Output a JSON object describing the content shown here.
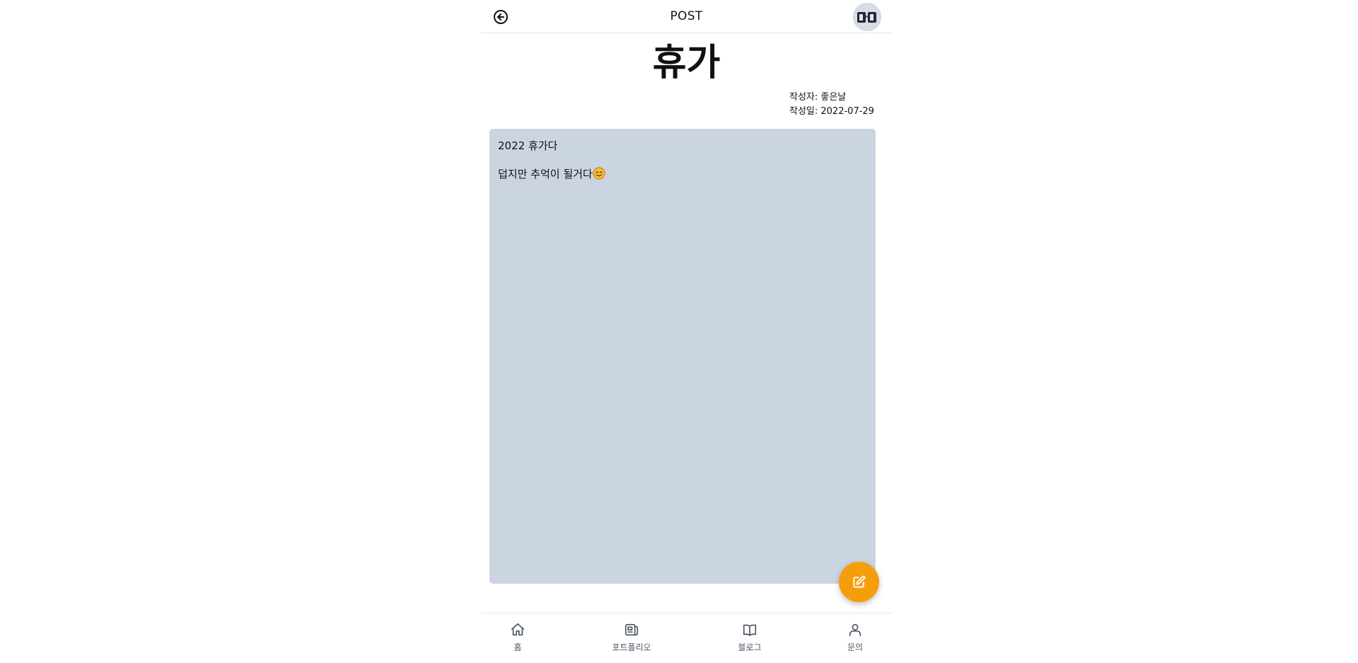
{
  "header": {
    "title": "POST",
    "back_icon": "arrow-left-circle-icon",
    "avatar_icon": "profile-avatar"
  },
  "post": {
    "title": "휴가",
    "author_line": "작성자: 좋은날",
    "date_line": "작성일: 2022-07-29",
    "paragraphs": [
      "2022 휴가다",
      "덥지만 추억이 될거다"
    ],
    "emoji": "smiling-face-emoji"
  },
  "fab": {
    "icon": "edit-icon",
    "color": "#f59e0b"
  },
  "colors": {
    "content_background": "#cbd5e1",
    "nav_text": "#4b5563"
  },
  "bottom_nav": {
    "items": [
      {
        "label": "홈",
        "icon": "home-icon"
      },
      {
        "label": "포트폴리오",
        "icon": "newspaper-icon"
      },
      {
        "label": "블로그",
        "icon": "book-open-icon"
      },
      {
        "label": "문의",
        "icon": "user-icon"
      }
    ]
  }
}
